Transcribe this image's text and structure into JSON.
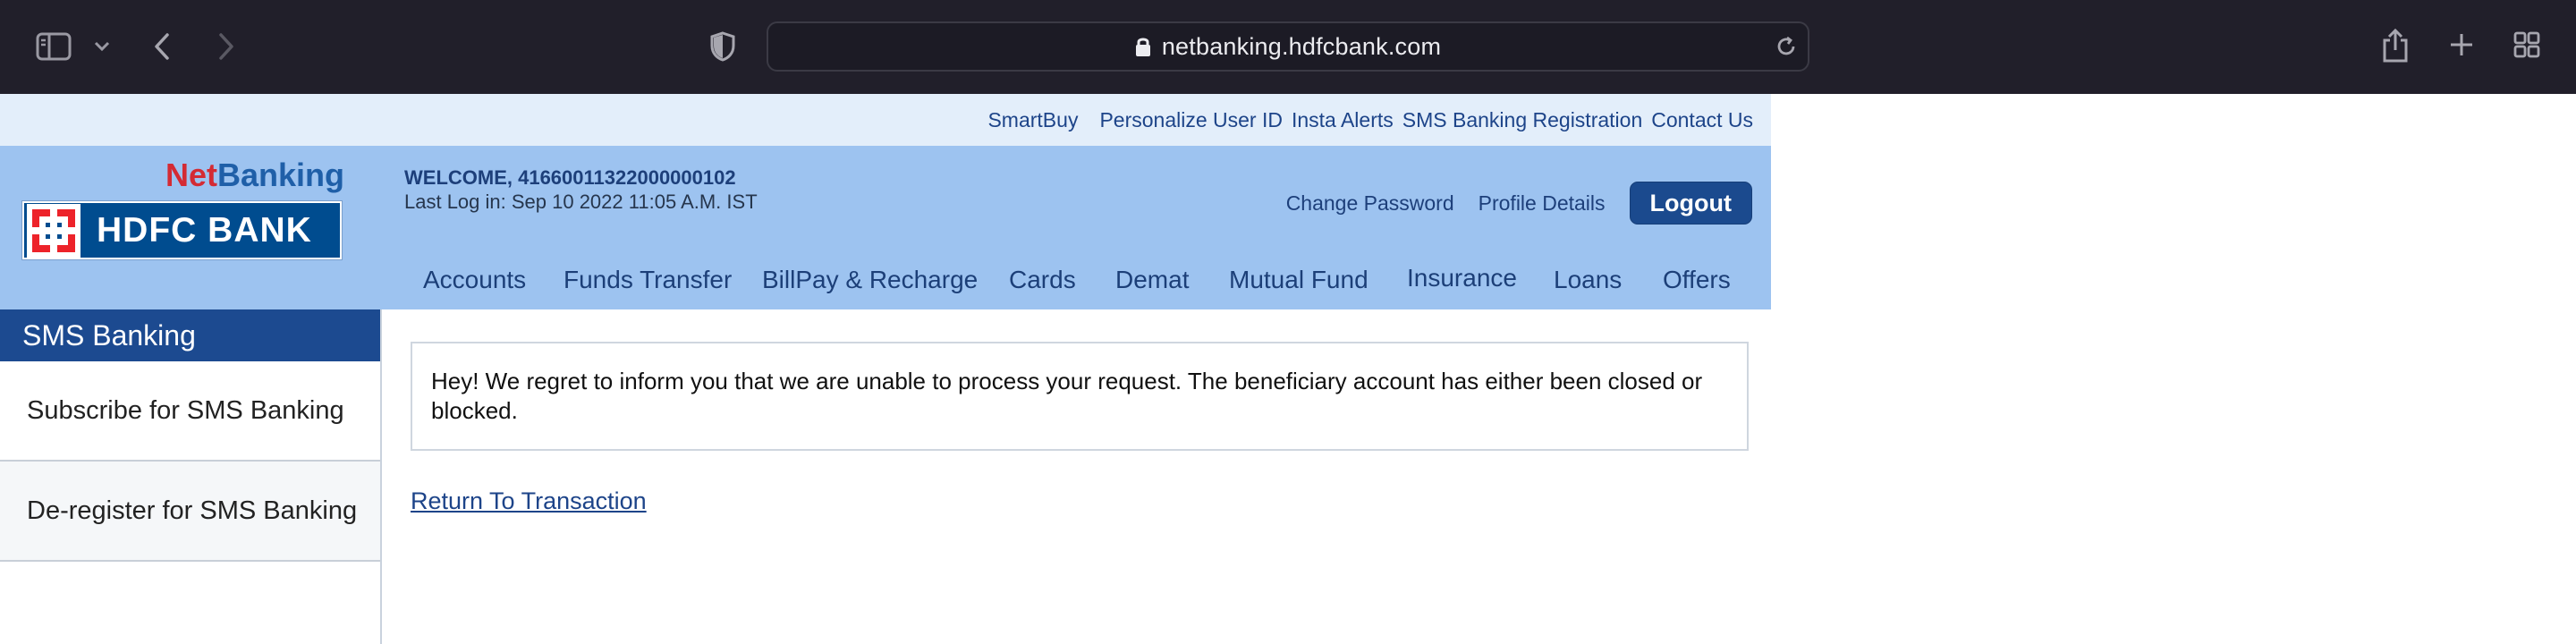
{
  "browser": {
    "url": "netbanking.hdfcbank.com",
    "icons": [
      "sidebar-toggle-icon",
      "chevron-down-icon",
      "back-arrow-icon",
      "forward-arrow-icon",
      "privacy-shield-icon",
      "lock-icon",
      "reload-icon",
      "share-icon",
      "new-tab-plus-icon",
      "tab-overview-icon"
    ]
  },
  "top_links": {
    "smartbuy": "SmartBuy",
    "personalize": "Personalize User ID",
    "insta_alerts": "Insta Alerts",
    "sms_registration": "SMS Banking Registration",
    "contact": "Contact Us"
  },
  "brand": {
    "net": "Net",
    "banking": "Banking",
    "bank_name": "HDFC BANK",
    "colors": {
      "brand_blue": "#004c8f",
      "brand_red": "#ed232a"
    }
  },
  "user": {
    "welcome": "WELCOME, 41660011322000000102",
    "last_login": "Last Log in: Sep 10 2022 11:05 A.M. IST"
  },
  "header_links": {
    "change_password": "Change Password",
    "profile_details": "Profile Details",
    "logout": "Logout"
  },
  "nav": {
    "accounts": "Accounts",
    "funds_transfer": "Funds Transfer",
    "billpay": "BillPay & Recharge",
    "cards": "Cards",
    "demat": "Demat",
    "mutual_fund": "Mutual Fund",
    "insurance": "Insurance",
    "loans": "Loans",
    "offers": "Offers"
  },
  "sidebar": {
    "title": "SMS Banking",
    "items": [
      "Subscribe for SMS Banking",
      "De-register for SMS Banking"
    ]
  },
  "main": {
    "message_line1": "Hey! We regret to inform you that we are unable to process your request. The beneficiary account has either been closed or",
    "message_line2": "blocked.",
    "return_link": "Return To Transaction"
  }
}
